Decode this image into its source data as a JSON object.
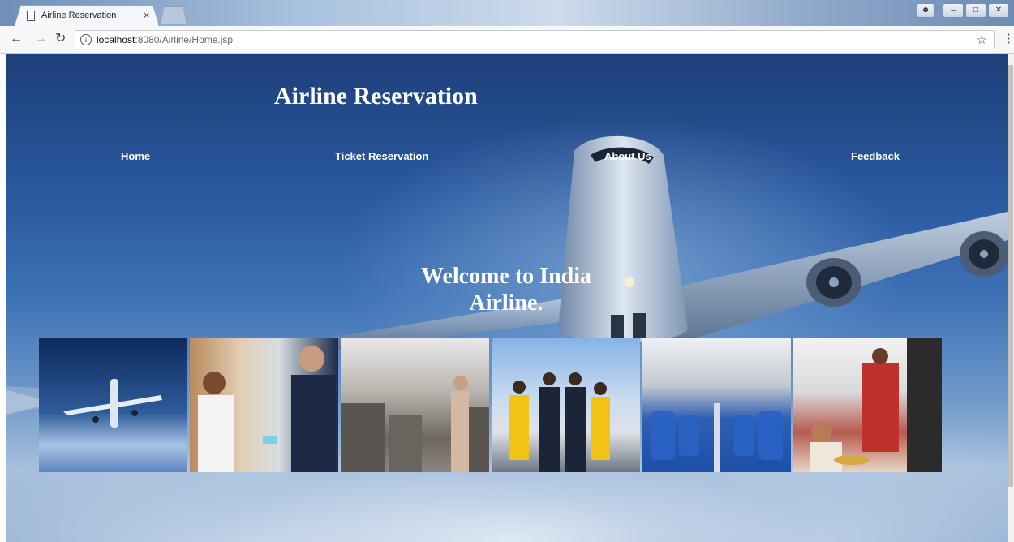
{
  "browser": {
    "tab_title": "Airline Reservation",
    "tab_close": "×",
    "url_host": "localhost",
    "url_path": ":8080/Airline/Home.jsp",
    "info": "i"
  },
  "page": {
    "title": "Airline Reservation",
    "nav": [
      "Home",
      "Ticket Reservation",
      "About Us",
      "Feedback"
    ],
    "welcome_line1": "Welcome to India",
    "welcome_line2": "Airline."
  },
  "gallery": [
    {
      "icon": "airplane-in-sky-photo"
    },
    {
      "icon": "check-in-counter-photo"
    },
    {
      "icon": "cabin-attendant-photo"
    },
    {
      "icon": "crew-group-photo"
    },
    {
      "icon": "empty-cabin-seats-photo"
    },
    {
      "icon": "in-flight-meal-photo"
    }
  ],
  "colors": {
    "nav_text": "#ffffff",
    "sky_dark": "#1d3f7a",
    "sky_light": "#a6bfdc"
  }
}
